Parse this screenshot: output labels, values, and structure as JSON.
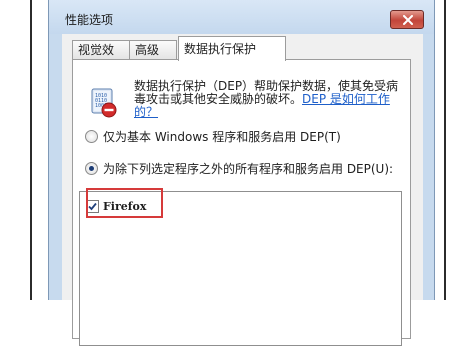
{
  "window": {
    "title": "性能选项"
  },
  "tabs": [
    {
      "label": "视觉效果",
      "selected": false
    },
    {
      "label": "高级",
      "selected": false
    },
    {
      "label": "数据执行保护",
      "selected": true
    }
  ],
  "dep": {
    "description": "数据执行保护（DEP）帮助保护数据，使其免受病毒攻击或其他安全威胁的破坏。",
    "link": "DEP 是如何工作的？",
    "option_basic": "仅为基本 Windows 程序和服务启用 DEP(T)",
    "option_all_except": "为除下列选定程序之外的所有程序和服务启用 DEP(U):",
    "selected_option": "option_all_except",
    "exceptions": [
      {
        "name": "Firefox",
        "checked": true
      }
    ]
  },
  "colors": {
    "highlight": "#d63a3a",
    "link": "#1e5fc9"
  },
  "icons": [
    "close-icon",
    "dep-shield-icon",
    "checkmark-icon"
  ]
}
